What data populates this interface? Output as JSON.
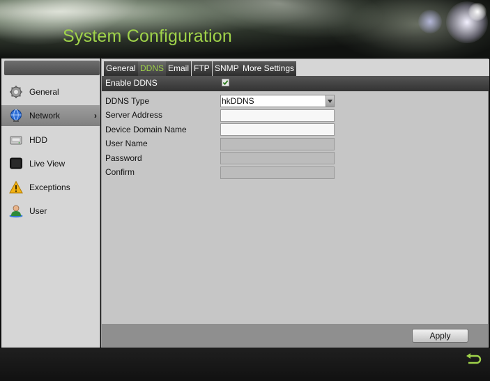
{
  "header": {
    "title": "System Configuration"
  },
  "sidebar": {
    "items": [
      {
        "label": "General",
        "icon": "gear-icon"
      },
      {
        "label": "Network",
        "icon": "network-globe-icon",
        "active": true
      },
      {
        "label": "HDD",
        "icon": "hdd-icon"
      },
      {
        "label": "Live View",
        "icon": "monitor-icon"
      },
      {
        "label": "Exceptions",
        "icon": "warning-icon"
      },
      {
        "label": "User",
        "icon": "user-icon"
      }
    ],
    "arrow": "›"
  },
  "tabs": [
    {
      "label": "General"
    },
    {
      "label": "DDNS",
      "active": true
    },
    {
      "label": "Email"
    },
    {
      "label": "FTP"
    },
    {
      "label": "SNMP"
    },
    {
      "label": "More Settings"
    }
  ],
  "form": {
    "enable_ddns": {
      "label": "Enable DDNS",
      "checked": true
    },
    "ddns_type": {
      "label": "DDNS Type",
      "value": "hkDDNS"
    },
    "server_address": {
      "label": "Server Address",
      "value": ""
    },
    "device_domain_name": {
      "label": "Device Domain Name",
      "value": ""
    },
    "user_name": {
      "label": "User Name",
      "value": ""
    },
    "password": {
      "label": "Password",
      "value": ""
    },
    "confirm": {
      "label": "Confirm",
      "value": ""
    }
  },
  "buttons": {
    "apply": "Apply"
  },
  "colors": {
    "accent": "#9fd24a",
    "active_tab_text": "#9fd24a"
  }
}
